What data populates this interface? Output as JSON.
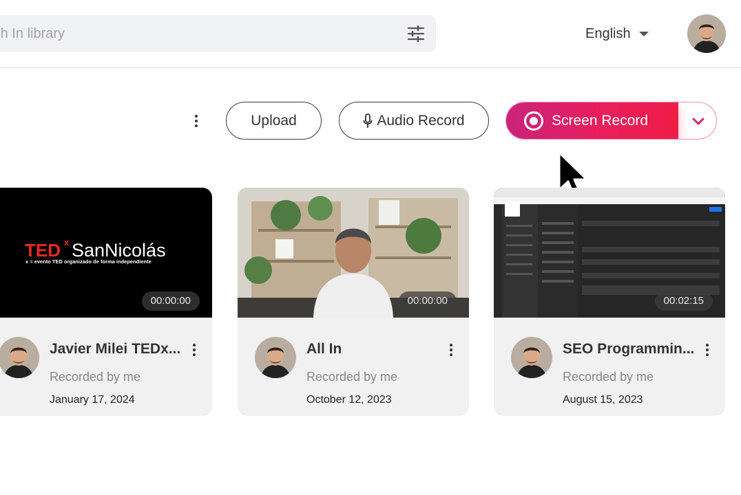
{
  "header": {
    "search_placeholder": "rch In library",
    "language": "English"
  },
  "actions": {
    "upload_label": "Upload",
    "audio_record_label": "Audio Record",
    "screen_record_label": "Screen Record"
  },
  "colors": {
    "accent_start": "#c9237a",
    "accent_end": "#ee1d46",
    "card_bg": "#f1f1f2"
  },
  "cards": [
    {
      "title": "Javier Milei TEDx...",
      "subtitle": "Recorded by me",
      "date": "January 17, 2024",
      "duration": "00:00:00",
      "thumb_brand": "TED",
      "thumb_brand_sup": "x",
      "thumb_event": "SanNicolás",
      "thumb_caption": "x = evento TED organizado de forma independiente"
    },
    {
      "title": "All In",
      "subtitle": "Recorded by me",
      "date": "October 12, 2023",
      "duration": "00:00:00"
    },
    {
      "title": "SEO Programmin...",
      "subtitle": "Recorded by me",
      "date": "August 15, 2023",
      "duration": "00:02:15"
    }
  ]
}
